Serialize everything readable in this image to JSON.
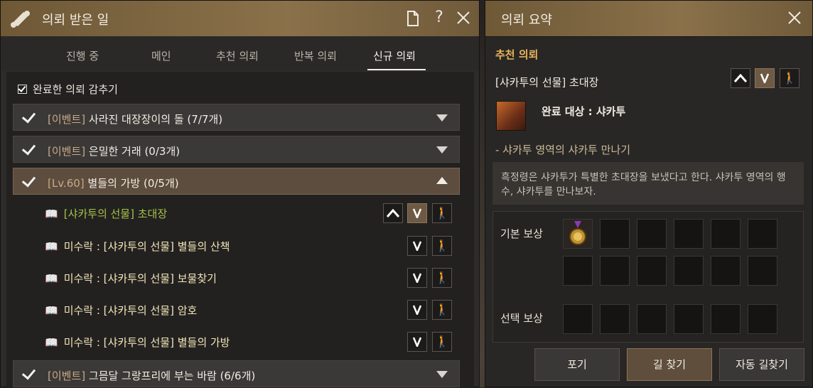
{
  "left": {
    "title": "의뢰 받은 일",
    "tabs": [
      "진행 중",
      "메인",
      "추천 의뢰",
      "반복 의뢰",
      "신규 의뢰"
    ],
    "active_tab": "신규 의뢰",
    "hide_completed": "완료한 의뢰 감추기",
    "categories": [
      {
        "prefix": "[이벤트]",
        "name": "사라진 대장장이의 돌",
        "count": "(7/7개)"
      },
      {
        "prefix": "[이벤트]",
        "name": "은밀한 거래",
        "count": "(0/3개)"
      },
      {
        "prefix": "[Lv.60]",
        "name": "별들의 가방",
        "count": "(0/5개)"
      },
      {
        "prefix": "[이벤트]",
        "name": "그믐달 그랑프리에 부는 바람",
        "count": "(6/6개)"
      }
    ],
    "quests": [
      "[샤카투의 선물] 초대장",
      "미수락 : [샤카투의 선물] 별들의 산책",
      "미수락 : [샤카투의 선물] 보물찾기",
      "미수락 : [샤카투의 선물] 암호",
      "미수락 : [샤카투의 선물] 별들의 가방"
    ]
  },
  "right": {
    "title": "의뢰 요약",
    "section": "추천 의뢰",
    "quest_title": "[샤카투의 선물] 초대장",
    "target": "완료 대상 : 샤카투",
    "objective": "- 샤카투 영역의 샤카투 만나기",
    "description": "흑정령은 샤카투가 특별한 초대장을 보냈다고 한다. 샤카투 영역의 행수, 샤카투를 만나보자.",
    "basic_reward": "기본 보상",
    "choice_reward": "선택 보상",
    "buttons": {
      "abandon": "포기",
      "navigate": "길 찾기",
      "auto_navigate": "자동 길찾기"
    }
  },
  "colors": {
    "header": "#8a714a",
    "highlight": "#a5c24a",
    "quest_text": "#f0e6b8",
    "section": "#e8b45a"
  }
}
